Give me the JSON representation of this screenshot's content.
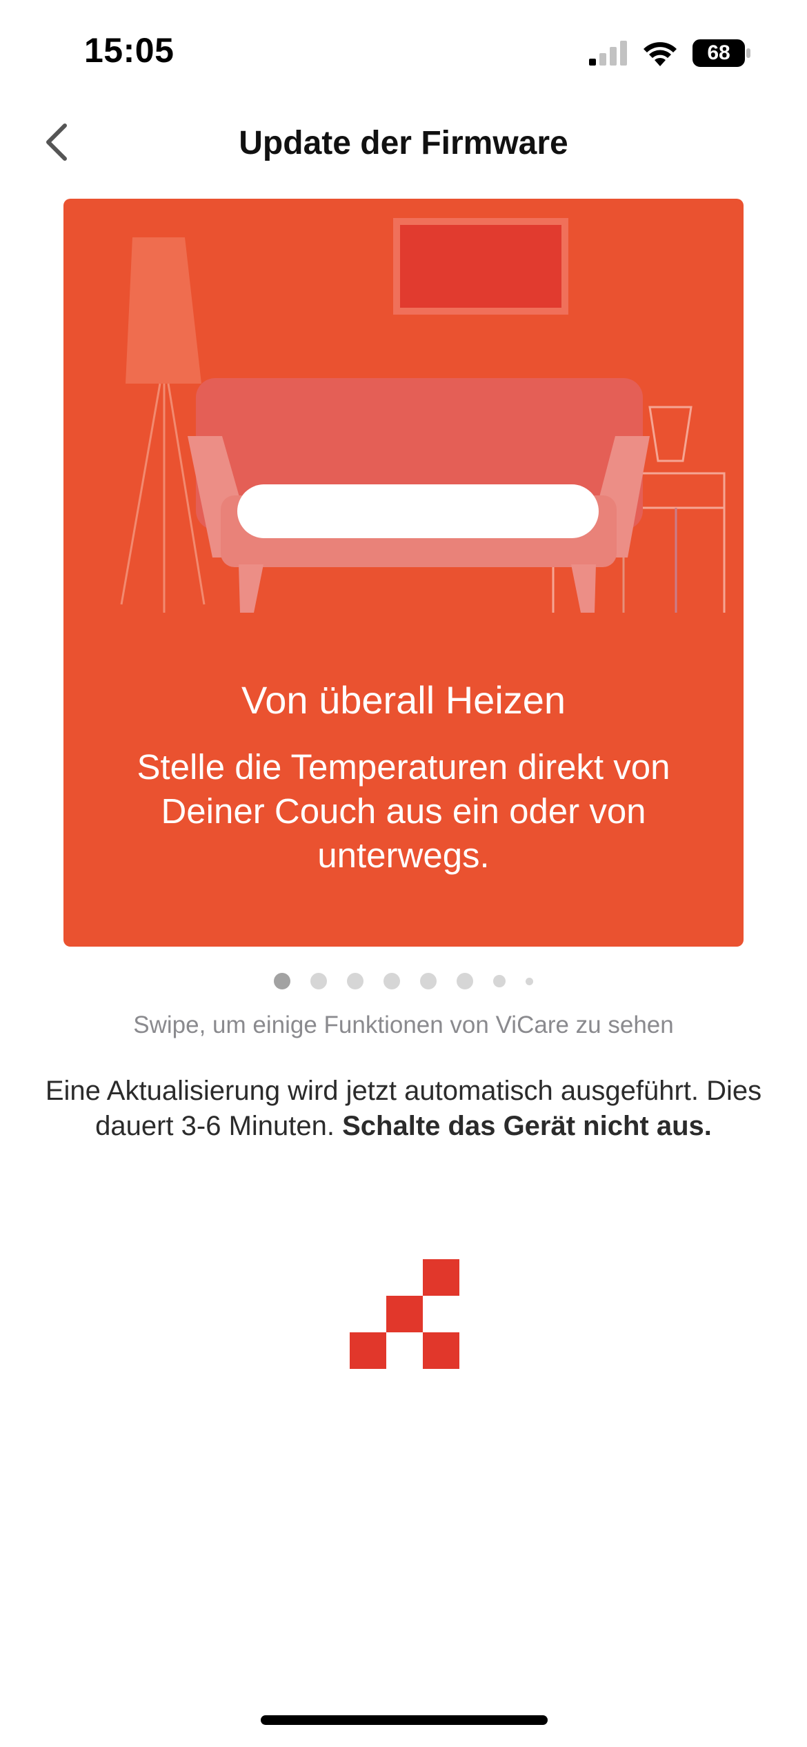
{
  "status_bar": {
    "time": "15:05",
    "battery": "68",
    "icons": [
      "signal-icon",
      "wifi-icon",
      "battery-icon"
    ]
  },
  "nav": {
    "title": "Update der Firmware",
    "back_icon": "chevron-left-icon"
  },
  "carousel": {
    "slide_title": "Von überall Heizen",
    "slide_text": "Stelle die Temperaturen direkt von Deiner Couch aus ein oder von unterwegs.",
    "illustration": "sofa-living-room-illustration",
    "background_color": "#ea5230",
    "page_count": 8,
    "active_page": 1
  },
  "swipe_hint": "Swipe, um einige Funktionen von ViCare zu sehen",
  "info": {
    "text": "Eine Aktualisierung wird jetzt automatisch ausgeführt. Dies dauert 3-6 Minuten.",
    "bold_text": "Schalte das Gerät nicht aus."
  },
  "loader": {
    "icon": "loading-squares-icon",
    "color": "#e1372b"
  }
}
